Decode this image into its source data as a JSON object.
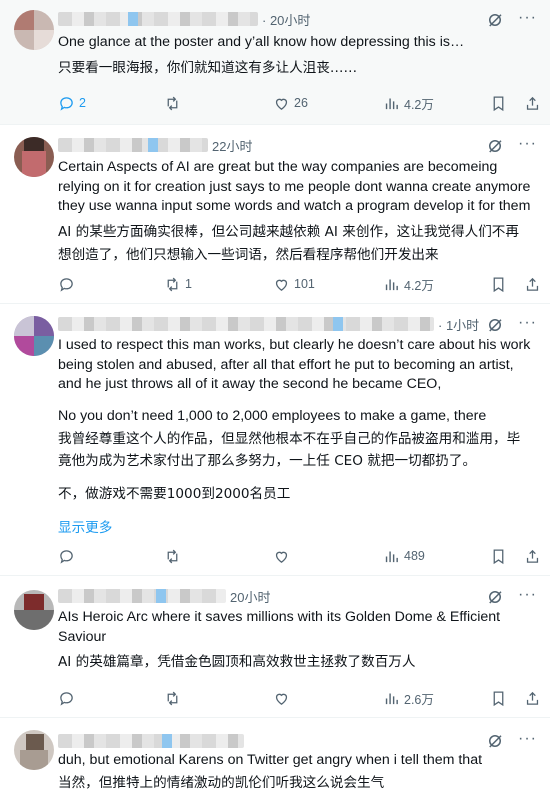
{
  "icons": {
    "reply": "reply-icon",
    "retweet": "retweet-icon",
    "like": "heart-icon",
    "views": "views-chart-icon",
    "bookmark": "bookmark-icon",
    "share": "share-icon",
    "grok": "grok-icon",
    "more": "more-icon"
  },
  "colors": {
    "accent": "#1d9bf0",
    "muted": "#536471",
    "text": "#0f1419",
    "highlight_bg": "#f7f9f9"
  },
  "posts": [
    {
      "time": "· 20小时",
      "lines": [
        "One glance at the poster and y’all know how depressing this is…",
        "只要看一眼海报，你们就知道这有多让人沮丧……"
      ],
      "show_more": "",
      "stats": {
        "reply": "2",
        "retweet": "",
        "like": "26",
        "views": "4.2万"
      }
    },
    {
      "time": "22小时",
      "lines": [
        "Certain Aspects of AI are great but the way companies are becomeing",
        "relying on it for creation just says to me people dont wanna create anymore",
        "they use wanna input some words and watch a program develop it for them",
        "AI 的某些方面确实很棒，但公司越来越依赖 AI 来创作，这让我觉得人们不再",
        "想创造了，他们只想输入一些词语，然后看程序帮他们开发出来"
      ],
      "show_more": "",
      "stats": {
        "reply": "",
        "retweet": "1",
        "like": "101",
        "views": "4.2万"
      }
    },
    {
      "time": "· 1小时",
      "lines": [
        "I used to respect this man works, but clearly he doesn’t care about his work",
        "being stolen and abused, after all that effort he put to becoming an artist,",
        "and he just throws all of it away the second he became CEO,",
        "",
        "No you don’t need 1,000 to 2,000 employees to make a game, there",
        "我曾经尊重这个人的作品，但显然他根本不在乎自己的作品被盗用和滥用，毕",
        "竟他为成为艺术家付出了那么多努力，一上任 CEO 就把一切都扔了。",
        "",
        "不，做游戏不需要1000到2000名员工"
      ],
      "show_more": "显示更多",
      "stats": {
        "reply": "",
        "retweet": "",
        "like": "",
        "views": "489"
      }
    },
    {
      "time": "20小时",
      "lines": [
        "AIs Heroic Arc where it saves millions with its Golden Dome & Efficient",
        "Saviour",
        "AI 的英雄篇章，凭借金色圆顶和高效救世主拯救了数百万人"
      ],
      "show_more": "",
      "stats": {
        "reply": "",
        "retweet": "",
        "like": "",
        "views": "2.6万"
      }
    },
    {
      "time": "",
      "lines": [
        "duh, but emotional Karens on Twitter  get angry when i tell them that",
        "当然，但推特上的情绪激动的凯伦们听我这么说会生气"
      ],
      "show_more": "",
      "stats": {
        "reply": "",
        "retweet": "",
        "like": "",
        "views": ""
      }
    }
  ]
}
